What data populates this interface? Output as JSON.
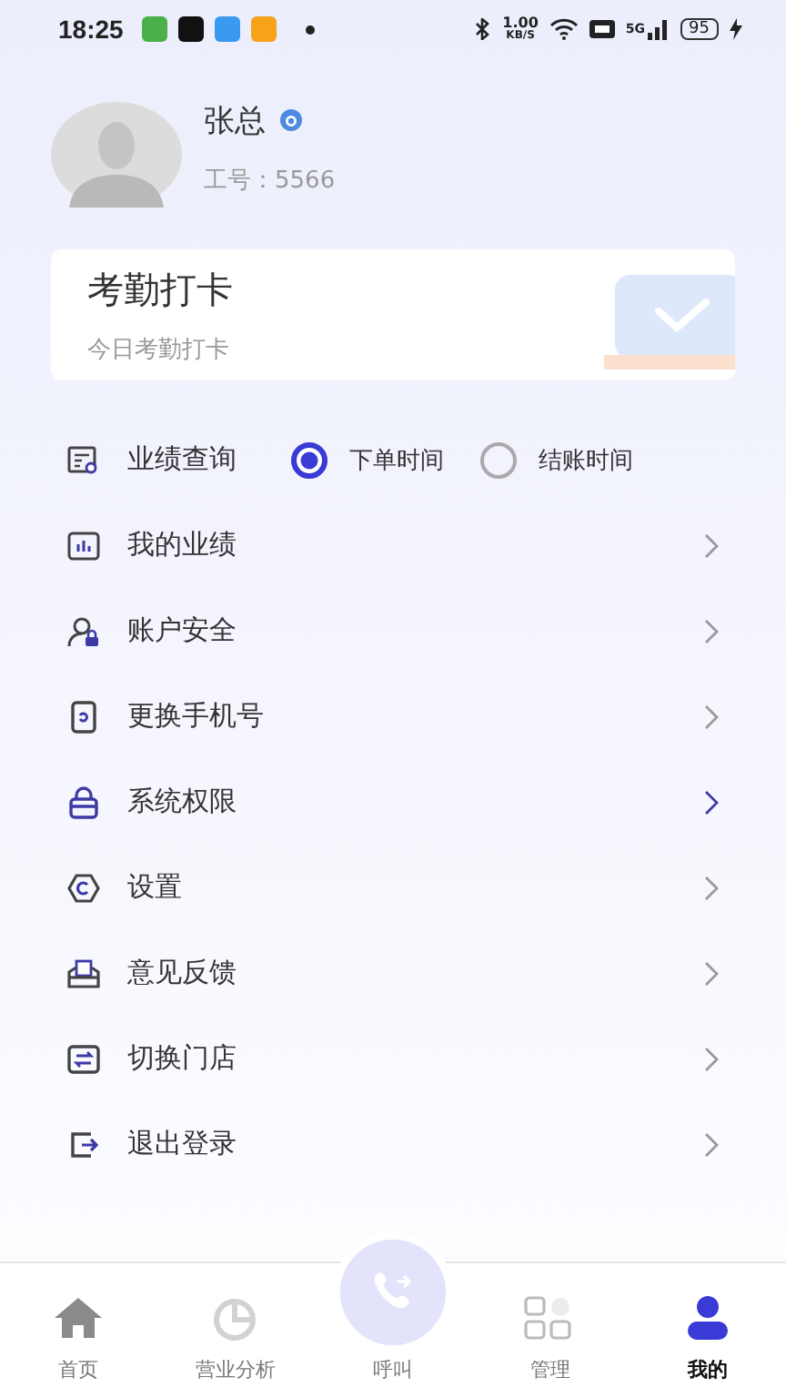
{
  "status_bar": {
    "time": "18:25",
    "speed": "1.00",
    "speed_unit": "KB/S",
    "network": "5G",
    "battery": "95"
  },
  "profile": {
    "name": "张总",
    "id_label": "工号：",
    "id_value": "5566"
  },
  "attendance_card": {
    "title": "考勤打卡",
    "subtitle": "今日考勤打卡"
  },
  "menu": [
    {
      "kind": "radio",
      "label": "业绩查询",
      "options": [
        {
          "label": "下单时间",
          "selected": true
        },
        {
          "label": "结账时间",
          "selected": false
        }
      ]
    },
    {
      "kind": "link",
      "label": "我的业绩"
    },
    {
      "kind": "link",
      "label": "账户安全"
    },
    {
      "kind": "link",
      "label": "更换手机号"
    },
    {
      "kind": "link",
      "label": "系统权限"
    },
    {
      "kind": "link",
      "label": "设置"
    },
    {
      "kind": "link",
      "label": "意见反馈"
    },
    {
      "kind": "link",
      "label": "切换门店"
    },
    {
      "kind": "link",
      "label": "退出登录"
    }
  ],
  "tab_bar": [
    {
      "label": "首页",
      "selected": false
    },
    {
      "label": "营业分析",
      "selected": false
    },
    {
      "label": "呼叫",
      "selected": false
    },
    {
      "label": "管理",
      "selected": false
    },
    {
      "label": "我的",
      "selected": true
    }
  ]
}
